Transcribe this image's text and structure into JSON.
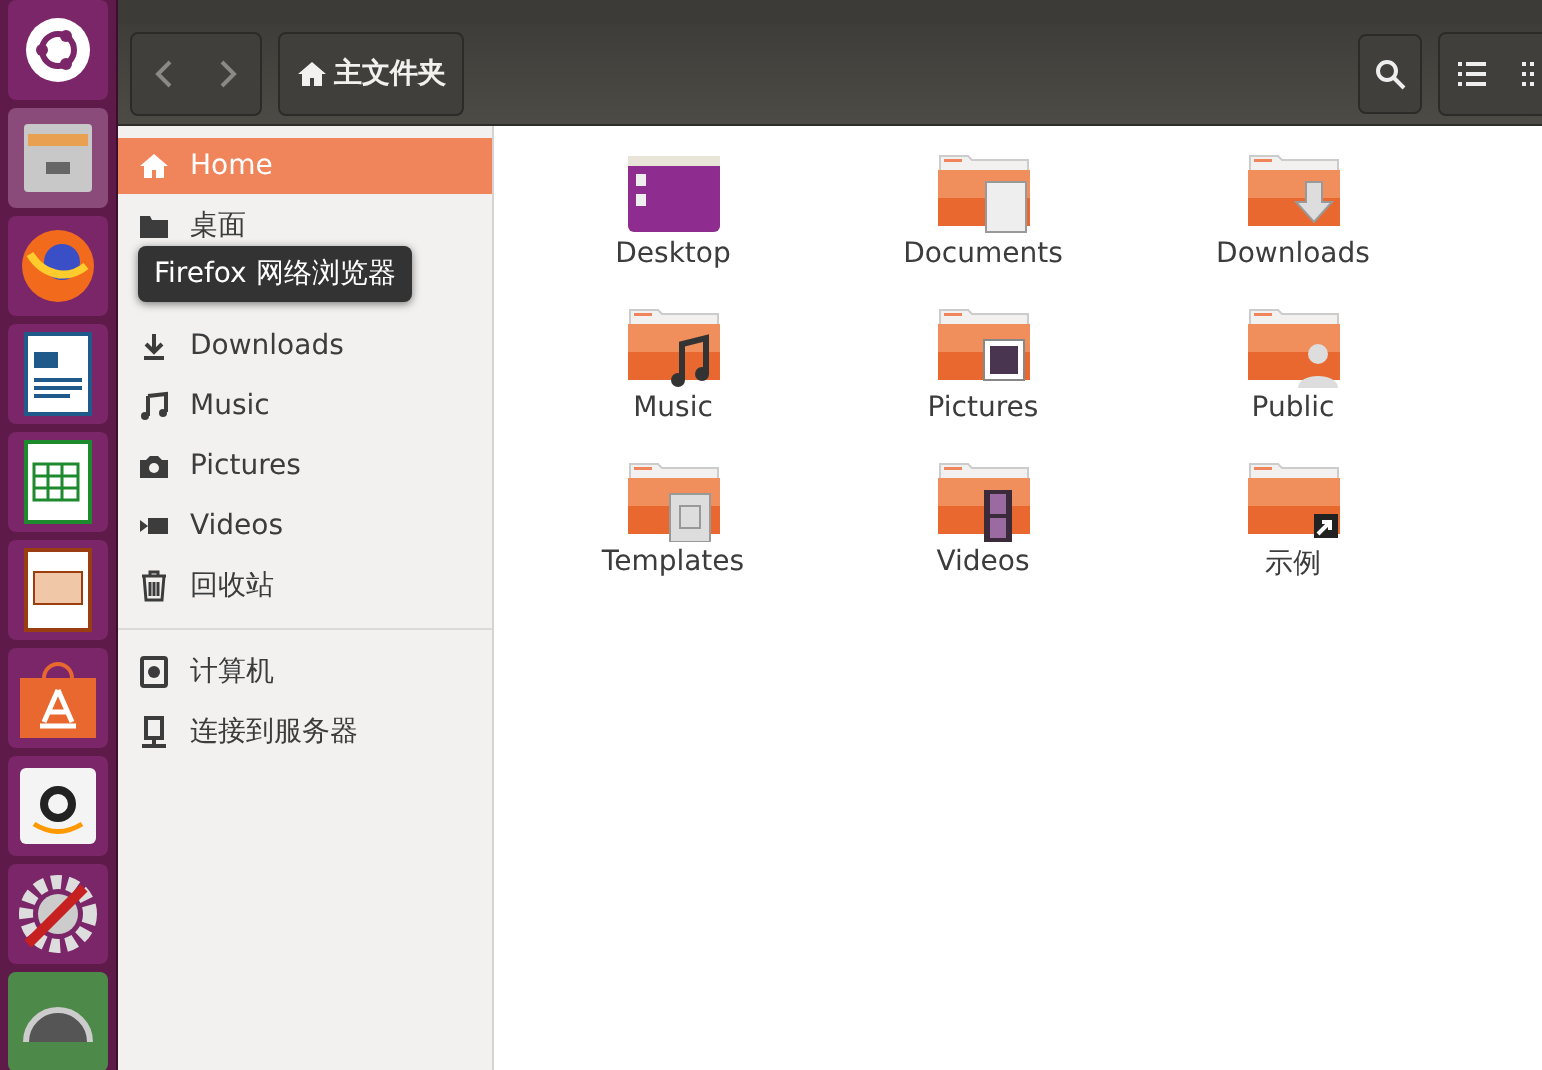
{
  "toolbar": {
    "location": "主文件夹"
  },
  "sidebar": {
    "sections": [
      [
        {
          "label": "Home",
          "selected": true
        },
        {
          "label": "桌面",
          "selected": false
        },
        {
          "label": "Downloads",
          "selected": false
        },
        {
          "label": "Music",
          "selected": false
        },
        {
          "label": "Pictures",
          "selected": false
        },
        {
          "label": "Videos",
          "selected": false
        },
        {
          "label": "回收站",
          "selected": false
        }
      ],
      [
        {
          "label": "计算机",
          "selected": false
        },
        {
          "label": "连接到服务器",
          "selected": false
        }
      ]
    ]
  },
  "tooltip": {
    "text": "Firefox 网络浏览器"
  },
  "folders": [
    {
      "name": "Desktop"
    },
    {
      "name": "Documents"
    },
    {
      "name": "Downloads"
    },
    {
      "name": "Music"
    },
    {
      "name": "Pictures"
    },
    {
      "name": "Public"
    },
    {
      "name": "Templates"
    },
    {
      "name": "Videos"
    },
    {
      "name": "示例"
    }
  ]
}
